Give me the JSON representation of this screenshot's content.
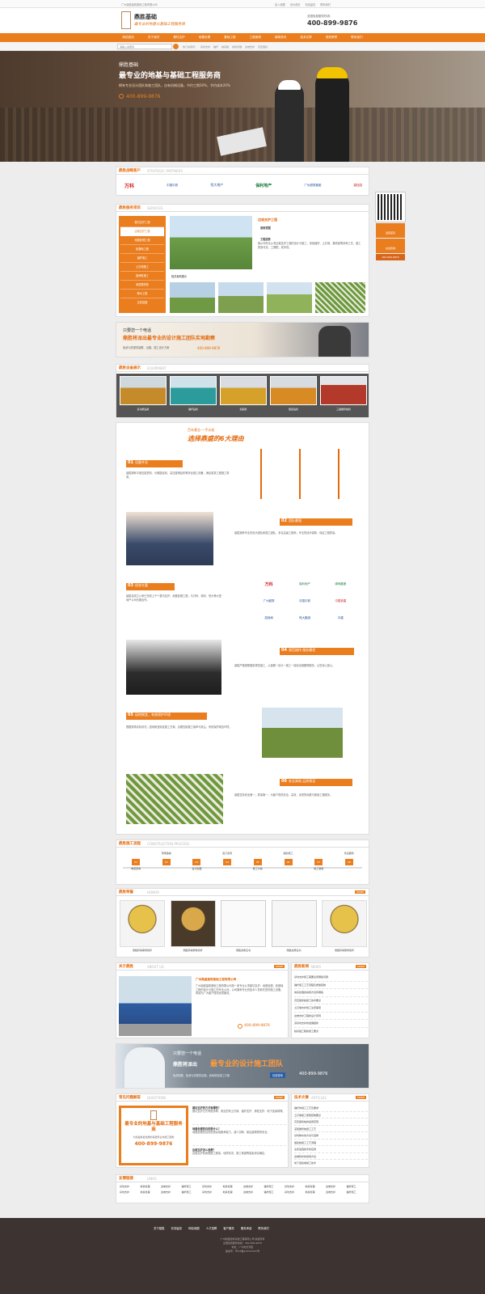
{
  "topbar": {
    "welcome": "广州鼎盛建筑基础工程有限公司",
    "links": [
      "加入收藏",
      "设为首页",
      "在线留言",
      "联系我们"
    ]
  },
  "header": {
    "logo_name": "鼎胜基础",
    "slogan": "最专业的地基与基础工程服务商",
    "hotline_label": "全国免费服务热线：",
    "hotline": "400-899-9876"
  },
  "nav": {
    "items": [
      "网站首页",
      "关于我们",
      "基坑支护",
      "地基处理",
      "基础工程",
      "工程案例",
      "新闻资讯",
      "技术文章",
      "资质荣誉",
      "联系我们"
    ]
  },
  "search": {
    "placeholder": "请输入关键词",
    "hot_label": "热门关键词：",
    "hot_words": [
      "基坑支护",
      "锚杆",
      "桩基础",
      "地基处理",
      "边坡支护",
      "高压旋喷"
    ]
  },
  "banner": {
    "brand": "鼎胜基础",
    "title": "最专业的地基与基础工程服务商",
    "sub": "拥有专业设计团队和施工团队，自有机械设备，节约工期30%，节约成本20%",
    "phone": "400-899-9876"
  },
  "partners": {
    "title": "鼎胜战略客户",
    "en": "STRATEGIC PARTNERS",
    "items": [
      "万科",
      "中国中铁",
      "恒大地产",
      "保利地产",
      "广州越秀集团",
      "碧桂园"
    ]
  },
  "services": {
    "title": "鼎胜服务项目",
    "en": "SERVICES",
    "menu": [
      "基坑支护工程",
      "边坡支护工程",
      "地基处理工程",
      "桩基础工程",
      "锚杆施工",
      "土钉墙施工",
      "旋喷桩施工",
      "深层搅拌桩",
      "降水工程",
      "注浆加固"
    ],
    "feature_title": "边坡支护工程",
    "feature_items": [
      "适用范围",
      "工程优势"
    ],
    "feature_text": "我公司专业从事边坡支护工程的设计与施工，采用锚杆、土钉墙、格构梁等多种工艺，施工质量可靠，工期短，成本低。",
    "case_label": "相关案例展示"
  },
  "ad1": {
    "line1": "只要您一个电话",
    "line2": "鼎胜将派出最专业的设计施工团队实地勘察",
    "line3": "免费为您提供勘察、出图、施工设计方案",
    "phone": "400-899-9876"
  },
  "equipment": {
    "title": "鼎胜设备展示",
    "en": "EQUIPMENT",
    "items": [
      "多功能钻机",
      "锚杆钻机",
      "挖掘机",
      "旋挖钻机",
      "三轴搅拌桩机"
    ]
  },
  "reasons": {
    "top": "百年基业·一手水准",
    "title": "选择鼎盛的6大理由",
    "items": [
      {
        "num": "01",
        "title": "设备齐全",
        "text": "鼎胜拥有中液压旋挖机、长螺旋钻机、高压旋喷钻机等多台施工设备，满足各类工程施工需求。"
      },
      {
        "num": "02",
        "title": "团队最强",
        "text": "鼎胜拥有专业的设计团队和施工团队，多名高级工程师，专业的技术保障，保证工程质量。"
      },
      {
        "num": "03",
        "title": "经验丰富",
        "text": "鼎胜自成立以来已完成上千个基坑支护、地基处理工程，与万科、保利、恒大等大型地产公司长期合作。"
      },
      {
        "num": "04",
        "title": "规范操作 服务最优",
        "text": "鼎胜严格按照国家规范施工，从勘察一设计一施工一验收全程跟踪服务，让您省心放心。"
      },
      {
        "num": "05",
        "title": "因地制宜，有效保护环境",
        "text": "根据现场实际情况，因地制宜制定施工方案，合理控制施工噪声与扬尘，有效保护周边环境。"
      },
      {
        "num": "06",
        "title": "安全高效 品质保证",
        "text": "鼎胜坚持安全第一，质量第一，为客户提供安全、高效、优质的地基与基础工程服务。"
      }
    ]
  },
  "partners2": [
    "万科",
    "保利地产",
    "绿地集团",
    "广州越秀",
    "中国中铁",
    "中国铁建",
    "招商局",
    "恒大集团",
    "中建"
  ],
  "process": {
    "title": "鼎胜施工流程",
    "en": "CONSTRUCTION PROCESS",
    "steps": [
      {
        "n": "01",
        "label": "电话咨询"
      },
      {
        "n": "02",
        "label": "现场勘察"
      },
      {
        "n": "03",
        "label": "设计出图"
      },
      {
        "n": "04",
        "label": "签订合同"
      },
      {
        "n": "05",
        "label": "施工方案"
      },
      {
        "n": "06",
        "label": "组织施工"
      },
      {
        "n": "07",
        "label": "竣工验收"
      },
      {
        "n": "08",
        "label": "售后服务"
      }
    ]
  },
  "honor": {
    "title": "鼎胜荣誉",
    "en": "HONOR",
    "more": "MORE",
    "items": [
      "鼎胜获得荣誉奖杯",
      "鼎胜获得荣誉奖杯",
      "鼎胜资质证书",
      "鼎胜资质证书",
      "鼎胜获得荣誉奖杯"
    ]
  },
  "about": {
    "title": "关于鼎胜",
    "en": "ABOUT US",
    "more": "MORE",
    "company": "广州鼎盛建筑基础工程有限公司",
    "text": "广州鼎盛建筑基础工程有限公司是一家专业从事基坑支护、地基处理、桩基础工程的设计与施工的专业公司，公司拥有专业的技术人员和先进的施工设备，竭诚为广大客户提供优质服务。",
    "phone": "400-899-9876"
  },
  "news": {
    "title": "鼎胜新闻",
    "en": "NEWS",
    "more": "MORE",
    "items": [
      "基坑支护施工需要注意哪些问题",
      "锚杆施工工艺流程及质量控制",
      "地基处理的常用方法有哪些",
      "高压旋喷桩施工技术要点",
      "土钉墙支护施工注意事项",
      "边坡支护工程的设计原则",
      "深基坑支护的发展趋势",
      "桩基础工程的施工要点"
    ]
  },
  "ad2": {
    "line1": "只要您一个电话",
    "line2a": "鼎胜将派出",
    "line2b": "最专业的设计施工团队",
    "line3": "免费勘察、免费为您提供出图，适地制宜施工方案",
    "btn": "在线咨询",
    "phone": "400-899-9876"
  },
  "faq": {
    "title": "常见问题解答",
    "en": "QUESTIONS",
    "more": "MORE",
    "box_title": "最专业的地基与基础工程服务商",
    "box_text": "为您提供最优质的基础专业化施工服务",
    "box_phone": "400-899-9876",
    "items": [
      {
        "q": "基坑支护的方式有哪些？",
        "a": "基坑支护方式有很多种，常见的有土钉墙、锚杆支护、排桩支护、地下连续墙等。"
      },
      {
        "q": "地基处理的目的是什么？",
        "a": "地基处理的目的是提高地基承载力，减少沉降，保证建筑物的安全。"
      },
      {
        "q": "边坡支护怎么收费？",
        "a": "边坡支护收费根据工程量、地质情况、施工难度等因素综合确定。"
      }
    ]
  },
  "tech": {
    "title": "技术文章",
    "en": "ARTICLES",
    "more": "MORE",
    "items": [
      "锚杆的施工工艺及要求",
      "土钉墙施工质量控制要点",
      "高压旋喷桩的适用范围",
      "深层搅拌桩施工工艺",
      "基坑降水的方法与选择",
      "旋挖桩施工工艺流程",
      "注浆加固技术的应用",
      "边坡防护的常用方法",
      "地下连续墙施工技术"
    ]
  },
  "links": {
    "title": "友情链接",
    "en": "LINKS",
    "items": [
      "基坑支护",
      "地基处理",
      "边坡支护",
      "锚杆施工",
      "基坑支护",
      "地基处理",
      "边坡支护",
      "锚杆施工",
      "基坑支护",
      "地基处理",
      "边坡支护",
      "锚杆施工",
      "基坑支护",
      "地基处理",
      "边坡支护",
      "锚杆施工",
      "基坑支护",
      "地基处理",
      "边坡支护",
      "锚杆施工",
      "基坑支护",
      "地基处理",
      "边坡支护",
      "锚杆施工"
    ]
  },
  "footer": {
    "nav": [
      "关于鼎胜",
      "在线留言",
      "网站地图",
      "人才招聘",
      "客户服务",
      "服务承诺",
      "联系我们"
    ],
    "lines": [
      "广州鼎盛建筑基础工程有限公司 版权所有",
      "全国免费服务热线：400-899-9876",
      "地址：广州市天河区",
      "备案号：粤ICP备XXXXXXXX号"
    ]
  },
  "float": {
    "items": [
      "返回首页",
      "在线咨询"
    ],
    "phone": "400-899-9876"
  }
}
